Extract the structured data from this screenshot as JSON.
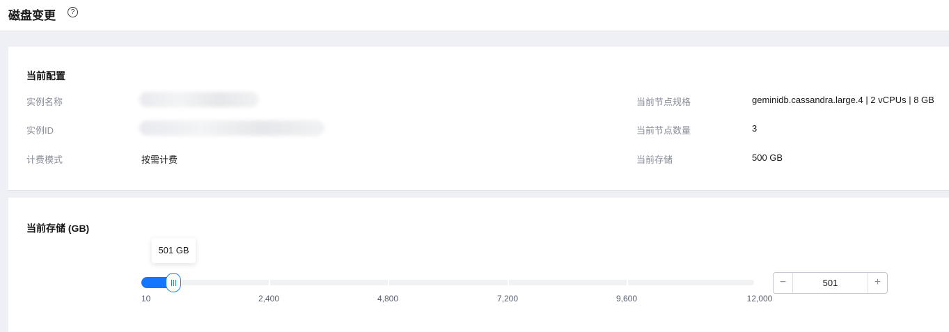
{
  "header": {
    "title": "磁盘变更",
    "help_icon": "question-circle-icon",
    "help_glyph": "?"
  },
  "config": {
    "title": "当前配置",
    "left": [
      {
        "label": "实例名称",
        "value": ""
      },
      {
        "label": "实例ID",
        "value": ""
      },
      {
        "label": "计费模式",
        "value": "按需计费"
      }
    ],
    "right": [
      {
        "label": "当前节点规格",
        "value": "geminidb.cassandra.large.4 | 2 vCPUs | 8 GB"
      },
      {
        "label": "当前节点数量",
        "value": "3"
      },
      {
        "label": "当前存储",
        "value": "500 GB"
      }
    ]
  },
  "storage": {
    "title": "当前存储 (GB)",
    "tooltip": "501 GB",
    "slider": {
      "min": 10,
      "max": 12000,
      "value": 501
    },
    "ticks": [
      "10",
      "2,400",
      "4,800",
      "7,200",
      "9,600",
      "12,000"
    ],
    "stepper": {
      "minus": "−",
      "plus": "+",
      "value": "501"
    }
  },
  "colors": {
    "accent": "#1476ff",
    "muted_text": "#8a8e99",
    "background": "#eff0f5"
  }
}
